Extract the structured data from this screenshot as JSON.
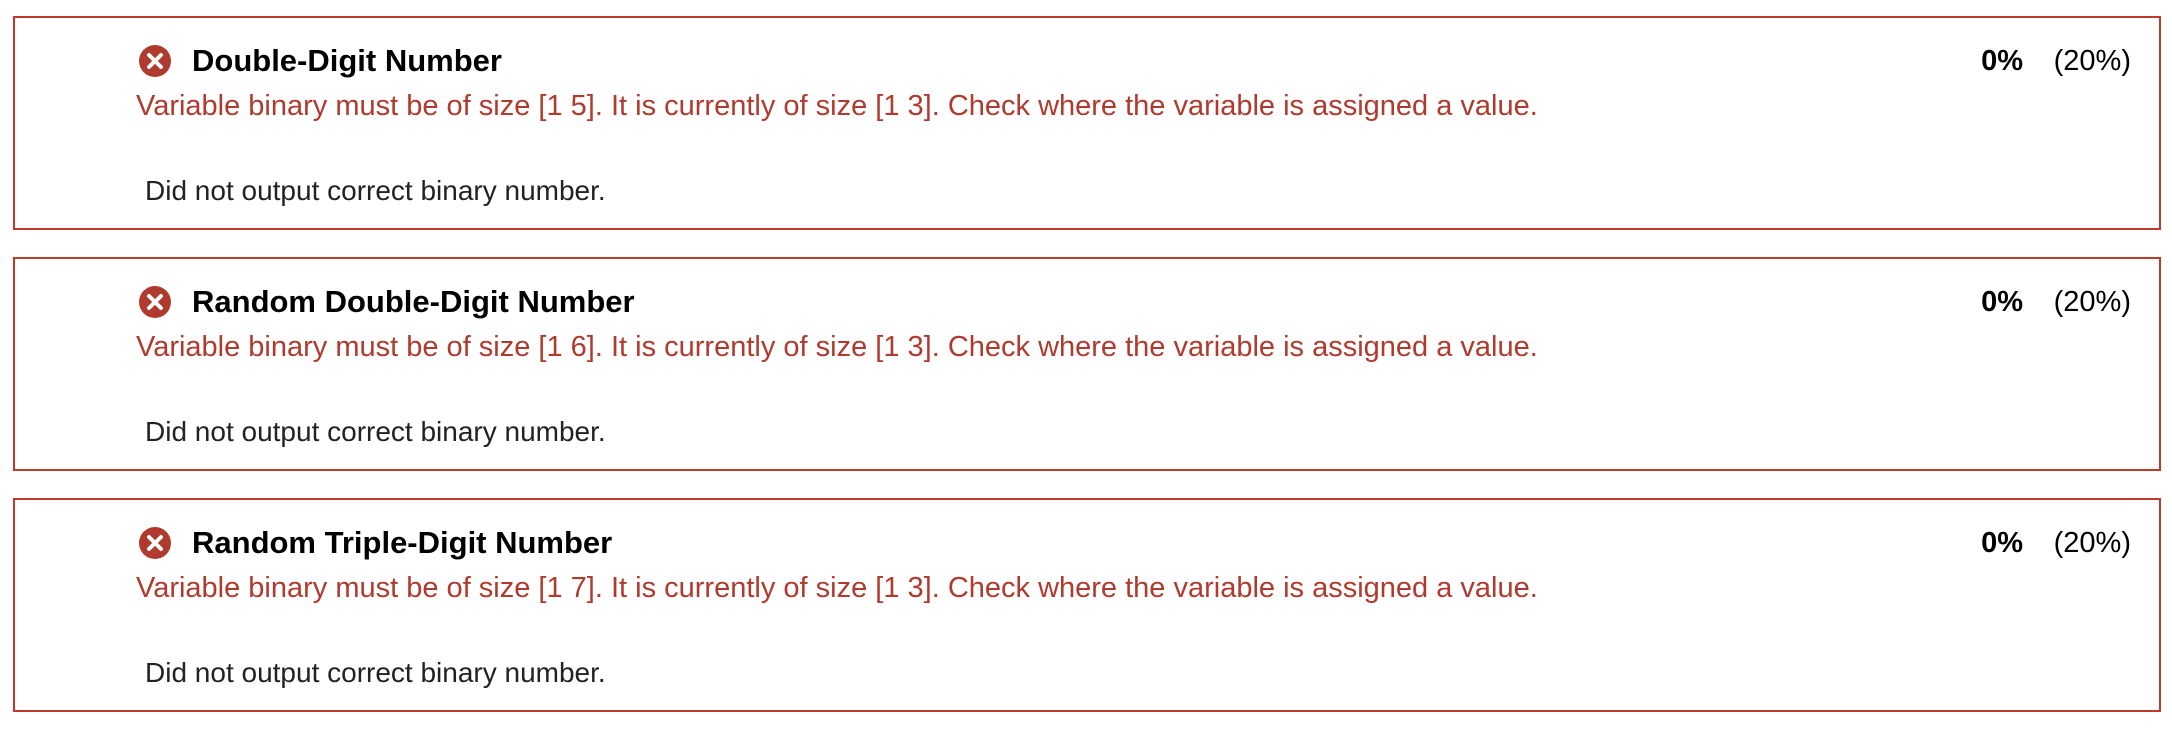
{
  "tests": [
    {
      "title": "Double-Digit Number",
      "score": "0%",
      "weight": "(20%)",
      "error": "Variable binary must be of size [1 5]. It is currently of size [1 3]. Check where the variable is assigned a value.",
      "feedback": "Did not output correct binary number.",
      "status_icon": "x-circle-icon"
    },
    {
      "title": "Random Double-Digit Number",
      "score": "0%",
      "weight": "(20%)",
      "error": "Variable binary must be of size [1 6]. It is currently of size [1 3]. Check where the variable is assigned a value.",
      "feedback": "Did not output correct binary number.",
      "status_icon": "x-circle-icon"
    },
    {
      "title": "Random Triple-Digit Number",
      "score": "0%",
      "weight": "(20%)",
      "error": "Variable binary must be of size [1 7]. It is currently of size [1 3]. Check where the variable is assigned a value.",
      "feedback": "Did not output correct binary number.",
      "status_icon": "x-circle-icon"
    }
  ],
  "colors": {
    "fail_border": "#c0392b",
    "error_text": "#b03a2e",
    "icon_fill": "#b03a2e"
  }
}
